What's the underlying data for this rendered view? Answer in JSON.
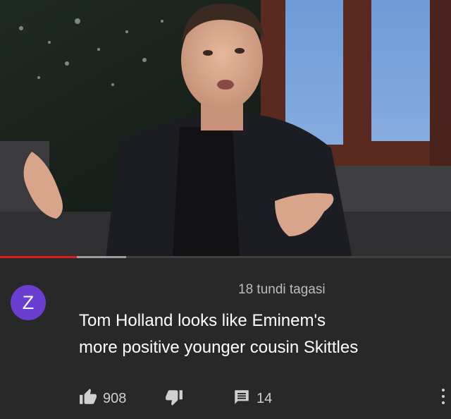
{
  "video": {
    "progress_played": 0.17,
    "progress_buffered": 0.28
  },
  "comment": {
    "avatar_letter": "Z",
    "avatar_color": "#6a3fd0",
    "timestamp": "18 tundi tagasi",
    "text_lines": [
      "Tom Holland looks like Eminem's",
      "more positive younger cousin Skittles"
    ],
    "likes": "908",
    "replies": "14"
  },
  "icons": [
    "thumbs-up-icon",
    "thumbs-down-icon",
    "reply-icon",
    "more-vert-icon"
  ]
}
